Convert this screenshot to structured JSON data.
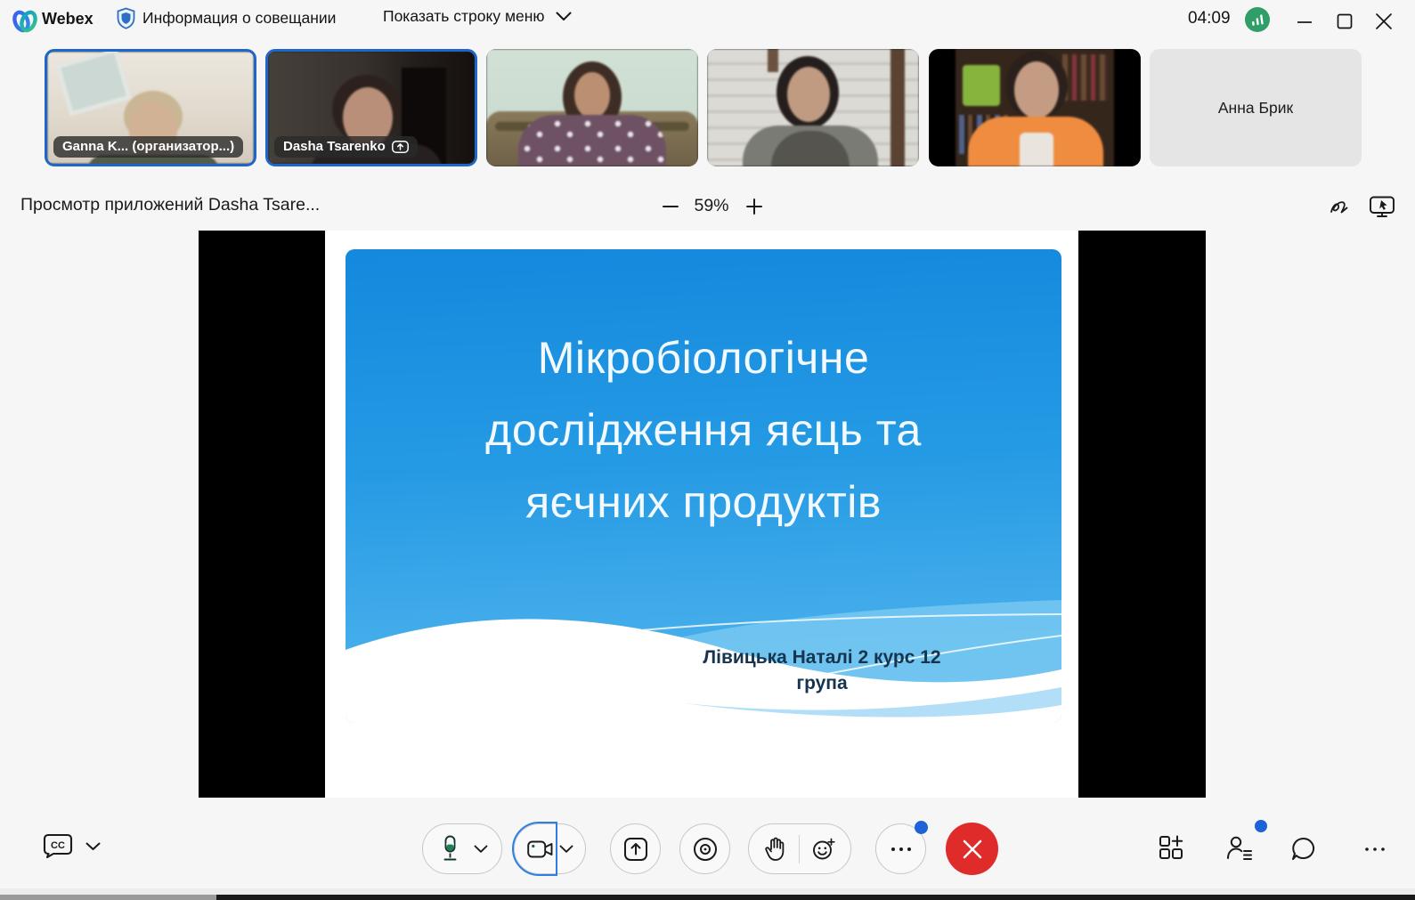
{
  "titlebar": {
    "app_name": "Webex",
    "meeting_info": "Информация о совещании",
    "show_menu_bar": "Показать строку меню",
    "time": "04:09"
  },
  "filmstrip": {
    "participants": [
      {
        "label": "Ganna K... (организатор...)"
      },
      {
        "label": "Dasha Tsarenko"
      },
      {
        "label": ""
      },
      {
        "label": ""
      },
      {
        "label": ""
      },
      {
        "label": "Анна Брик"
      }
    ]
  },
  "share_header": {
    "title": "Просмотр приложений Dasha Tsare...",
    "zoom_level": "59%"
  },
  "slide": {
    "title_lines": [
      "Мікробіологічне",
      "дослідження яєць та",
      "яєчних продуктів"
    ],
    "author_lines": [
      "Лівицька Наталі  2 курс 12",
      "група"
    ]
  },
  "controls": {
    "cc_label": "CC"
  },
  "colors": {
    "accent_blue": "#1d62d6",
    "active_tile_border": "#1e66c7",
    "leave_red": "#e02b2b",
    "quality_green": "#2f9e68",
    "slide_blue_top": "#1489dd",
    "slide_blue_bottom": "#55b6ee"
  }
}
